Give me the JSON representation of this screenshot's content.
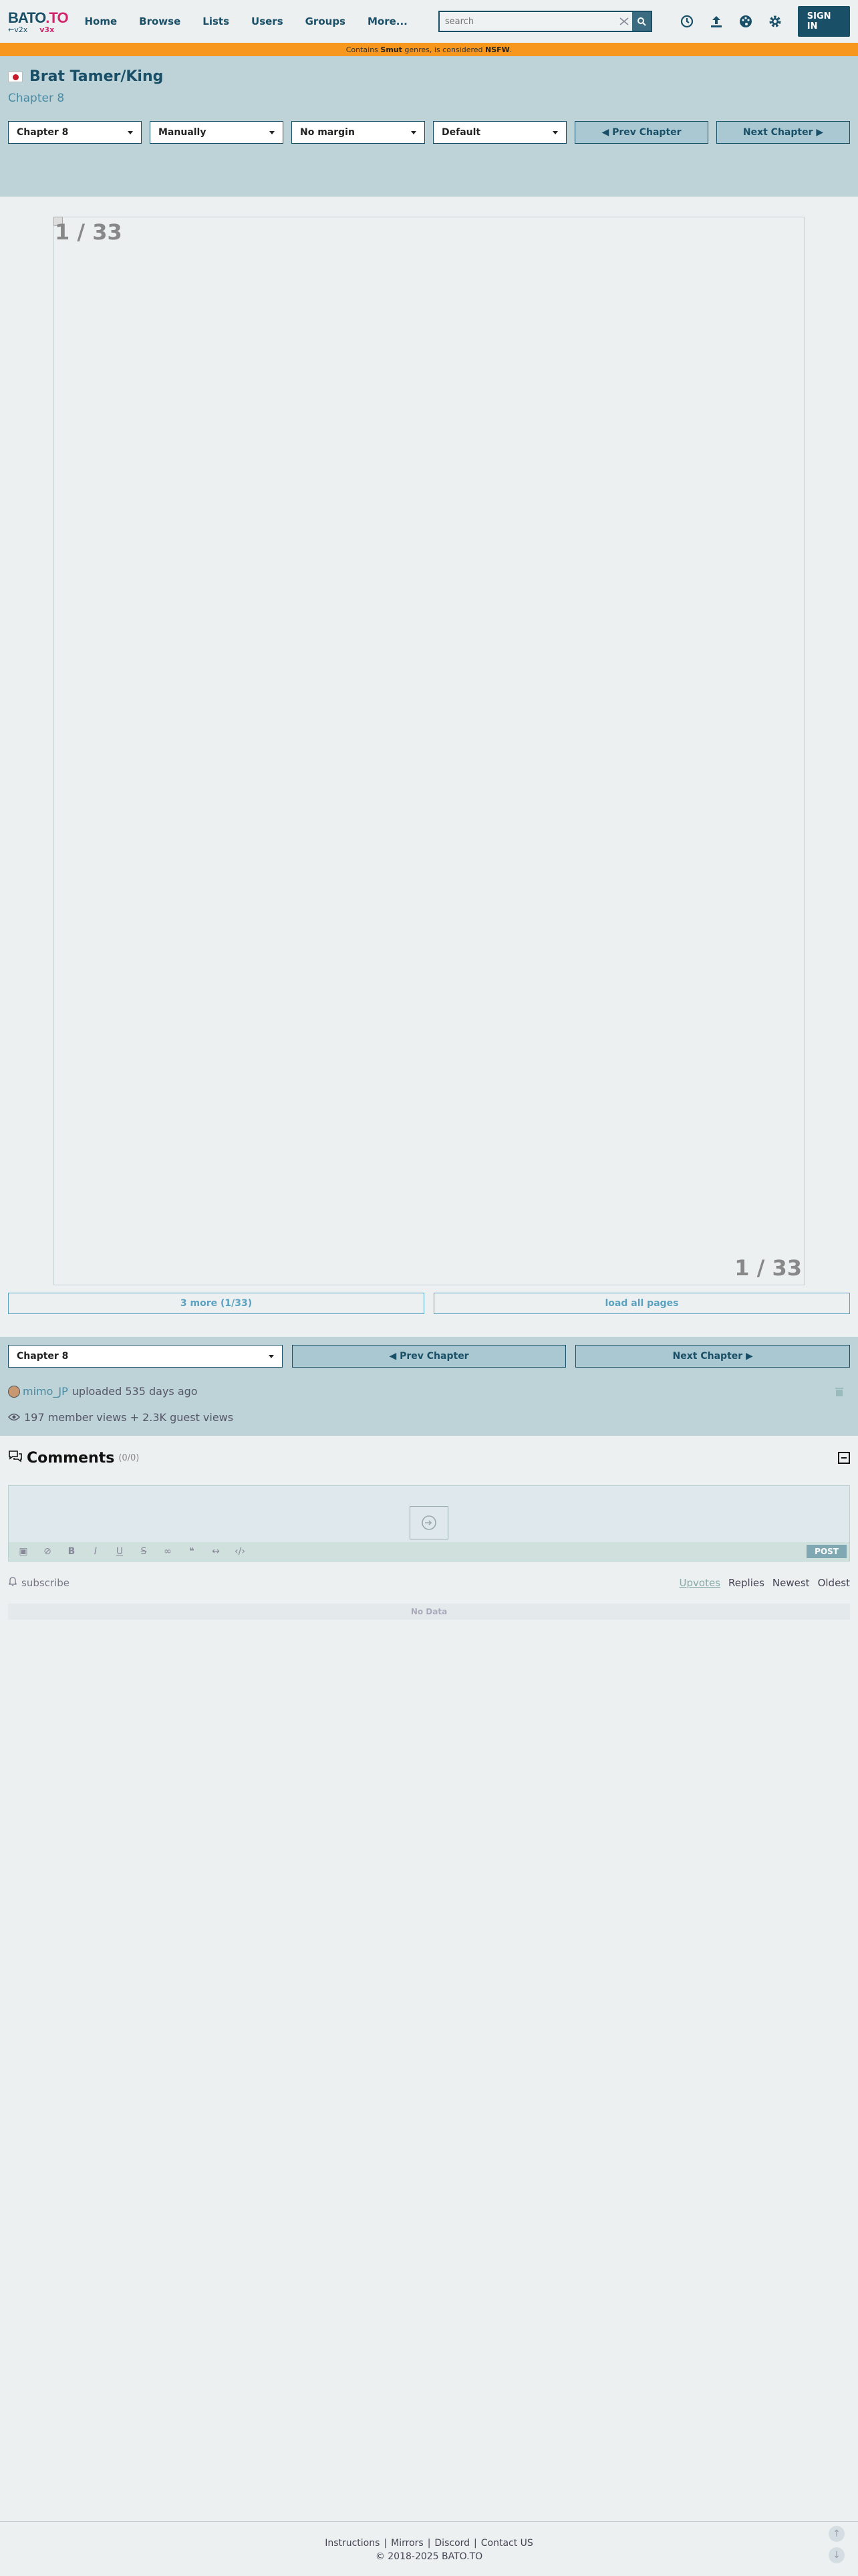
{
  "header": {
    "logo_text": "BATO",
    "logo_tld": ".TO",
    "logo_sub_left": "←v2x",
    "logo_sub_right": "v3x",
    "nav": [
      "Home",
      "Browse",
      "Lists",
      "Users",
      "Groups",
      "More..."
    ],
    "search_placeholder": "search",
    "signin_label": "SIGN IN"
  },
  "notice": {
    "prefix": "Contains ",
    "genre": "Smut",
    "middle": " genres, is considered ",
    "label": "NSFW",
    "suffix": "."
  },
  "series": {
    "title": "Brat Tamer/King",
    "chapter": "Chapter 8"
  },
  "controls": {
    "chapter_select": "Chapter 8",
    "load_mode": "Manually",
    "margin_mode": "No margin",
    "image_mode": "Default",
    "prev_label": "◀ Prev Chapter",
    "next_label": "Next Chapter ▶"
  },
  "reader": {
    "page_indicator": "1 / 33",
    "more_label": "3 more (1/33)",
    "load_all_label": "load all pages"
  },
  "upload": {
    "user": "mimo_JP",
    "text": "uploaded 535 days ago",
    "views": "197 member views + 2.3K guest views"
  },
  "comments": {
    "title": "Comments",
    "count": "(0/0)",
    "post_label": "POST",
    "subscribe_label": "subscribe",
    "sorts": [
      "Upvotes",
      "Replies",
      "Newest",
      "Oldest"
    ],
    "no_data": "No Data"
  },
  "footer": {
    "links": [
      "Instructions",
      "Mirrors",
      "Discord",
      "Contact US"
    ],
    "copyright": "© 2018-2025 BATO.TO"
  },
  "colors": {
    "brand": "#1a4f68",
    "accent_pink": "#d2246c",
    "nsfw_bar": "#f7971d",
    "panel": "#bdd3d8",
    "link": "#4a8aa2"
  },
  "icons": [
    "search-icon",
    "clear-icon",
    "history-icon",
    "upload-icon",
    "palette-icon",
    "gear-icon",
    "trash-icon",
    "eye-icon",
    "chat-icon",
    "bell-icon",
    "login-icon",
    "arrow-up-icon",
    "arrow-down-icon"
  ]
}
